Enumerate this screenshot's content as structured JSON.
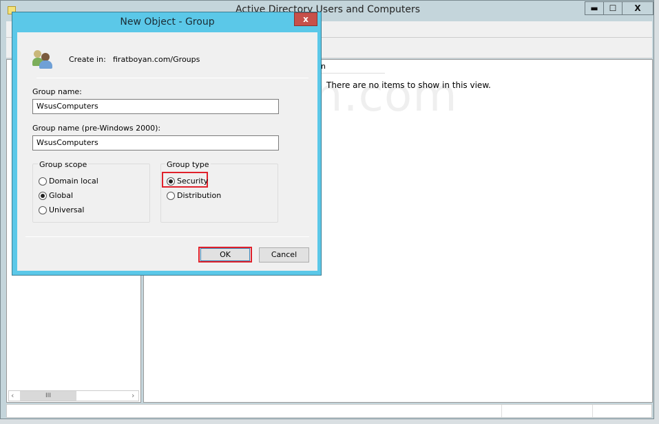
{
  "main_window": {
    "title": "Active Directory Users and Computers",
    "column_header_fragment": "n",
    "empty_message": "There are no items to show in this view.",
    "controls": {
      "minimize": "▬",
      "maximize": "☐",
      "close": "X"
    }
  },
  "watermark": "firatboyan.com",
  "dialog": {
    "title": "New Object - Group",
    "close": "x",
    "create_in_label": "Create in:",
    "create_in_value": "firatboyan.com/Groups",
    "group_name_label": "Group name:",
    "group_name_value": "WsusComputers",
    "group_name_pre2000_label": "Group name (pre-Windows 2000):",
    "group_name_pre2000_value": "WsusComputers",
    "group_scope": {
      "label": "Group scope",
      "options": [
        "Domain local",
        "Global",
        "Universal"
      ],
      "selected": "Global"
    },
    "group_type": {
      "label": "Group type",
      "options": [
        "Security",
        "Distribution"
      ],
      "selected": "Security"
    },
    "ok_label": "OK",
    "cancel_label": "Cancel",
    "highlight_color": "#e0202a",
    "title_bar_color": "#5bc8e8"
  },
  "scrollbar": {
    "thumb": "III",
    "left": "‹",
    "right": "›"
  }
}
